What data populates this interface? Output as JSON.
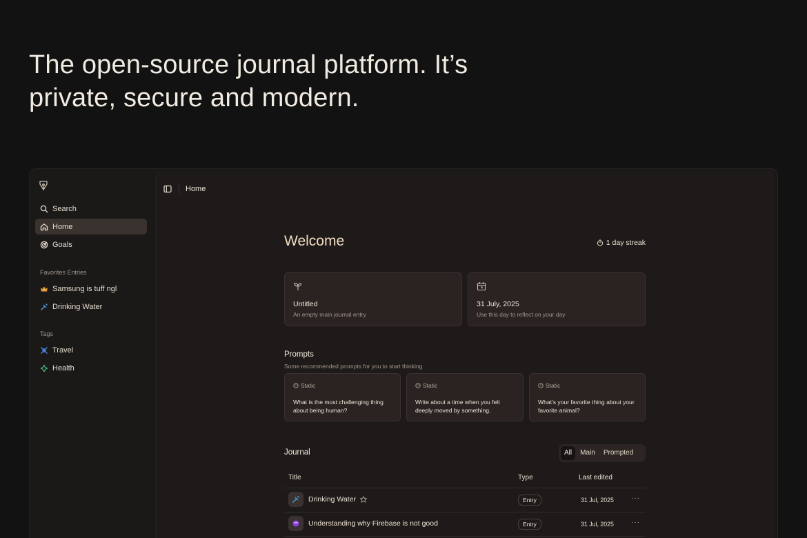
{
  "hero": {
    "line1": "The open-source journal platform. It’s",
    "line2": "private, secure and modern."
  },
  "sidebar": {
    "logo_icon": "pen-nib-icon",
    "nav": [
      {
        "label": "Search",
        "icon": "search-icon"
      },
      {
        "label": "Home",
        "icon": "home-icon",
        "active": true
      },
      {
        "label": "Goals",
        "icon": "target-icon"
      }
    ],
    "favorites_label": "Favorites Entries",
    "favorites": [
      {
        "label": "Samsung is tuff ngl",
        "icon": "crown-icon",
        "color": "#e7a33a"
      },
      {
        "label": "Drinking Water",
        "icon": "syringe-icon",
        "color": "#4a9fe6"
      }
    ],
    "tags_label": "Tags",
    "tags": [
      {
        "label": "Travel",
        "icon": "plane-icon",
        "color": "#4c86e0"
      },
      {
        "label": "Health",
        "icon": "sparkle-icon",
        "color": "#3fb67a"
      }
    ]
  },
  "topbar": {
    "breadcrumb": "Home"
  },
  "main": {
    "welcome": "Welcome",
    "streak": "1 day streak",
    "cards": [
      {
        "title": "Untitled",
        "subtitle": "An empty main journal entry",
        "icon": "sprout-icon"
      },
      {
        "title": "31 July, 2025",
        "subtitle": "Use this day to reflect on your day",
        "icon": "calendar-icon"
      }
    ],
    "prompts_title": "Prompts",
    "prompts_subtitle": "Some recommended prompts for you to start thinking",
    "prompts": [
      {
        "tag": "Static",
        "text": "What is the most challenging thing about being human?"
      },
      {
        "tag": "Static",
        "text": "Write about a time when you felt deeply moved by something."
      },
      {
        "tag": "Static",
        "text": "What's your favorite thing about your favorite animal?"
      }
    ],
    "journal_title": "Journal",
    "filters": [
      "All",
      "Main",
      "Prompted"
    ],
    "active_filter": "All",
    "table": {
      "headers": {
        "title": "Title",
        "type": "Type",
        "last_edited": "Last edited"
      },
      "rows": [
        {
          "title": "Drinking Water",
          "icon": "syringe-icon",
          "starred": true,
          "type": "Entry",
          "date": "31 Jul, 2025"
        },
        {
          "title": "Understanding why Firebase is not good",
          "icon": "purple-orb-icon",
          "starred": false,
          "type": "Entry",
          "date": "31 Jul, 2025"
        }
      ]
    }
  },
  "colors": {
    "background": "#121212",
    "panel": "#1e1a19",
    "card": "#2a2322",
    "accent_text": "#f2dcc3"
  }
}
